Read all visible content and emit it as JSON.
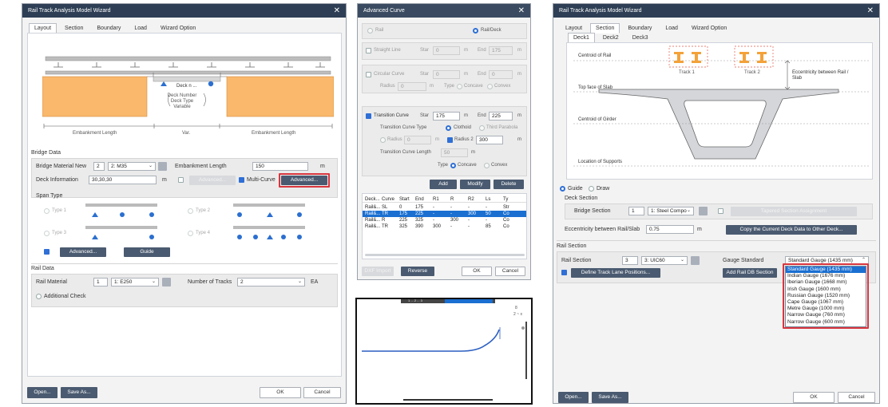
{
  "left": {
    "title": "Rail Track Analysis Model Wizard",
    "tabs": [
      "Layout",
      "Section",
      "Boundary",
      "Load",
      "Wizard Option"
    ],
    "diagram": {
      "deck_label": "Deck n ...",
      "deck_note": "Deck Number Deck Type Variable",
      "emb_left": "Embankment Length",
      "var": "Var.",
      "emb_right": "Embankment Length"
    },
    "bridge_data": {
      "header": "Bridge Data",
      "material_label": "Bridge Material New",
      "material_num": "2",
      "material_sel": "2: M35",
      "emb_label": "Embankment Length",
      "emb_value": "150",
      "emb_unit": "m",
      "deck_info_label": "Deck Information",
      "deck_info_value": "30,30,30",
      "deck_unit": "m",
      "advanced_disabled": "Advanced...",
      "multicurve_label": "Multi-Curve",
      "advanced_active": "Advanced..."
    },
    "span": {
      "header": "Span Type",
      "type1": "Type 1",
      "type2": "Type 2",
      "type3": "Type 3",
      "type4": "Type 4",
      "advanced_btn": "Advanced...",
      "guide_btn": "Guide"
    },
    "rail_data": {
      "header": "Rail Data",
      "material_label": "Rail Material",
      "material_num": "1",
      "material_sel": "1: E250",
      "tracks_label": "Number of Tracks",
      "tracks_value": "2",
      "tracks_unit": "EA",
      "additional": "Additional Check"
    },
    "footer": {
      "open": "Open...",
      "saveas": "Save As...",
      "ok": "OK",
      "cancel": "Cancel"
    }
  },
  "middle": {
    "title": "Advanced Curve",
    "rail": "Rail",
    "raildeck": "Rail/Deck",
    "straight": {
      "label": "Straight Line",
      "sta": "Star",
      "sta_val": "0",
      "unit": "m",
      "end": "End",
      "end_val": "175",
      "end_unit": "m"
    },
    "circular": {
      "label": "Circular Curve",
      "sta": "Star",
      "sta_val": "0",
      "unit": "m",
      "end": "End",
      "end_val": "0",
      "end_unit": "m",
      "radius": "Radius",
      "radius_val": "0",
      "radius_unit": "m",
      "type": "Type",
      "concave": "Concave",
      "convex": "Convex"
    },
    "transition": {
      "label": "Transition Curve",
      "sta": "Star",
      "sta_val": "175",
      "unit": "m",
      "end": "End",
      "end_val": "225",
      "end_unit": "m",
      "tct": "Transition Curve Type",
      "clothoid": "Clothoid",
      "third": "Third Parabola",
      "r1": "Radius 1",
      "r1_val": "0",
      "r1_unit": "m",
      "r2": "Radius 2",
      "r2_val": "300",
      "r2_unit": "m",
      "tcl": "Transition Curve Length",
      "tcl_val": "50",
      "tcl_unit": "m",
      "type": "Type",
      "concave": "Concave",
      "convex": "Convex"
    },
    "buttons": {
      "add": "Add",
      "modify": "Modify",
      "delete": "Delete"
    },
    "table": {
      "headers": [
        "Deck...",
        "Curve",
        "Start",
        "End",
        "R1",
        "R",
        "R2",
        "Ls",
        "Ty"
      ],
      "rows": [
        [
          "Rail&...",
          "SL",
          "0",
          "175",
          "-",
          "-",
          "-",
          "-",
          "Str"
        ],
        [
          "Rail&...",
          "TR",
          "175",
          "225",
          "-",
          "-",
          "300",
          "50",
          "Co"
        ],
        [
          "Rail&...",
          "R",
          "225",
          "325",
          "-",
          "300",
          "-",
          "-",
          "Co"
        ],
        [
          "Rail&...",
          "TR",
          "325",
          "390",
          "300",
          "-",
          "-",
          "85",
          "Co"
        ]
      ]
    },
    "footer": {
      "dxf": "DXF Import",
      "reverse": "Reverse",
      "ok": "OK",
      "cancel": "Cancel"
    }
  },
  "plot": {
    "top_text": "1 ... 2 ... 3",
    "legend1": "8",
    "legend2": "2 ~ x"
  },
  "right": {
    "title": "Rail Track Analysis Model Wizard",
    "tabs": [
      "Layout",
      "Section",
      "Boundary",
      "Load",
      "Wizard Option"
    ],
    "decks": [
      "Deck1",
      "Deck2",
      "Deck3"
    ],
    "section": {
      "centroid_rail": "Centroid of Rail",
      "track1": "Track 1",
      "track2": "Track 2",
      "ecc": "Eccentricity between Rail / Slab",
      "top_slab": "Top face of Slab",
      "centroid_girder": "Centroid of Girder",
      "supports": "Location of Supports"
    },
    "guide": "Guide",
    "draw": "Draw",
    "deck_section": {
      "header": "Deck Section",
      "label": "Bridge Section",
      "num": "1",
      "sel": "1: Steel Compo",
      "tapered": "Tapered Section Assignment",
      "ecc_label": "Eccentricity between Rail/Slab",
      "ecc_value": "0.75",
      "ecc_unit": "m",
      "copy_btn": "Copy the Current Deck Data to Other Deck..."
    },
    "rail_section": {
      "header": "Rail Section",
      "label": "Rail Section",
      "num": "3",
      "sel": "3: UIC60",
      "define_btn": "Define Track Lane Positions...",
      "gauge_label": "Gauge Standard",
      "gauge_value": "Standard Gauge (1435 mm)",
      "add_btn": "Add Rail DB Section",
      "options": [
        "Standard Gauge (1435 mm)",
        "Indian Gauge (1676 mm)",
        "Iberian Gauge (1668 mm)",
        "Irish Gauge (1600 mm)",
        "Russian Gauge (1520 mm)",
        "Cape Gauge (1067 mm)",
        "Metre Gauge (1000 mm)",
        "Narrow Gauge (760 mm)",
        "Narrow Gauge (600 mm)"
      ]
    },
    "footer": {
      "open": "Open...",
      "saveas": "Save As...",
      "ok": "OK",
      "cancel": "Cancel"
    }
  },
  "colors": {
    "titlebar": "#2e3f55",
    "accent": "#2f6fd6",
    "deck_fill": "#f9b86b",
    "highlight": "#d9363e"
  }
}
